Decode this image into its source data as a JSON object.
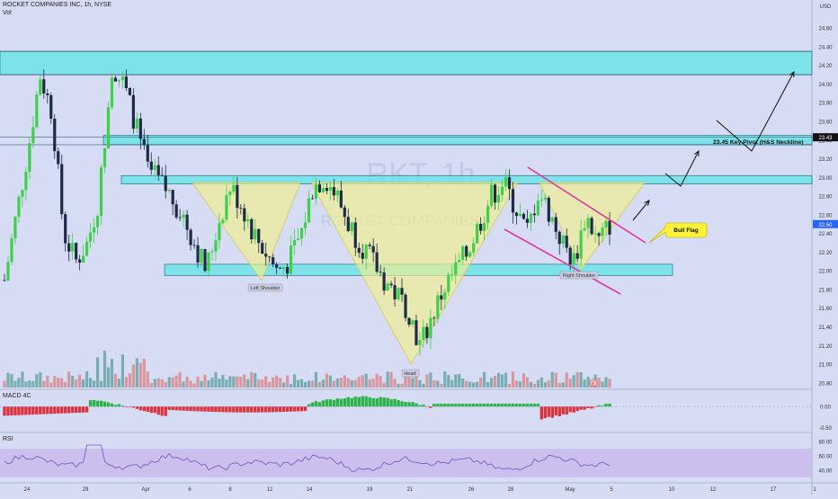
{
  "header": {
    "symbol_line": "ROCKET COMPANIES INC, 1h, NYSE",
    "vol_label": "Vol"
  },
  "watermark": {
    "ticker": "RKT, 1h",
    "name": "ROCKET COMPANIES"
  },
  "annotations": {
    "pivot_label": "23.45 Key Pivot (H&S Neckline)",
    "bull_flag": "Bull Flag",
    "left_shoulder": "Left Shoulder",
    "head": "Head",
    "right_shoulder": "Right Shoulder",
    "earnings_marker": "E"
  },
  "colors": {
    "background": "#d6dcf3",
    "bull": "#3fcf49",
    "bear": "#1d2a45",
    "zone": "#6fe3e8",
    "pattern": "#f1ef8e",
    "channel": "#e0379a",
    "rsi_band": "#c8b8ec",
    "price_tag": "#2962ff",
    "pivot_tag": "#111111"
  },
  "chart_data": {
    "type": "candlestick",
    "x_tick_labels": [
      "24",
      "29",
      "Apr",
      "6",
      "8",
      "12",
      "14",
      "19",
      "21",
      "26",
      "28",
      "May",
      "5",
      "10",
      "12",
      "17",
      "1"
    ],
    "y_tick_labels": [
      "24.60",
      "24.40",
      "24.20",
      "24.00",
      "23.80",
      "23.60",
      "23.40",
      "23.20",
      "23.00",
      "22.80",
      "22.60",
      "22.40",
      "22.20",
      "22.00",
      "21.80",
      "21.60",
      "21.40",
      "21.20",
      "21.00",
      "20.80"
    ],
    "y_currency": "USD",
    "ylim": [
      20.75,
      24.9
    ],
    "last_price_label": "22.50",
    "pivot_price_label": "23.43",
    "resistance_zones": [
      [
        24.1,
        24.35
      ],
      [
        22.93,
        23.02
      ],
      [
        23.35,
        23.45
      ]
    ],
    "support_zone": [
      21.95,
      22.07
    ],
    "projection_path": [
      [
        22.6,
        22.85
      ],
      [
        23.15,
        23.3
      ],
      [
        23.0,
        23.7
      ],
      [
        23.4,
        24.3
      ]
    ],
    "approx_close_path": [
      21.9,
      22.6,
      23.3,
      24.1,
      23.7,
      22.4,
      22.1,
      22.3,
      22.8,
      24.2,
      24.0,
      23.6,
      23.1,
      22.95,
      22.8,
      22.6,
      22.3,
      22.0,
      22.5,
      22.9,
      22.7,
      22.4,
      22.2,
      22.0,
      22.1,
      22.4,
      22.9,
      23.0,
      22.8,
      22.5,
      22.3,
      22.1,
      21.9,
      21.75,
      21.6,
      21.2,
      21.5,
      21.8,
      22.0,
      22.2,
      22.5,
      22.8,
      22.95,
      22.7,
      22.4,
      22.85,
      22.6,
      22.3,
      22.1,
      22.6,
      22.3,
      22.5
    ],
    "volume_axis_visible": false,
    "macd": {
      "label": "MACD 4C",
      "y_tick_labels": [
        "0.00",
        "-0.50"
      ],
      "ylim": [
        -0.6,
        0.35
      ]
    },
    "rsi": {
      "label": "RSI",
      "y_tick_labels": [
        "80.00",
        "60.00",
        "40.00"
      ],
      "ylim": [
        25,
        90
      ],
      "band": [
        30,
        70
      ]
    }
  }
}
